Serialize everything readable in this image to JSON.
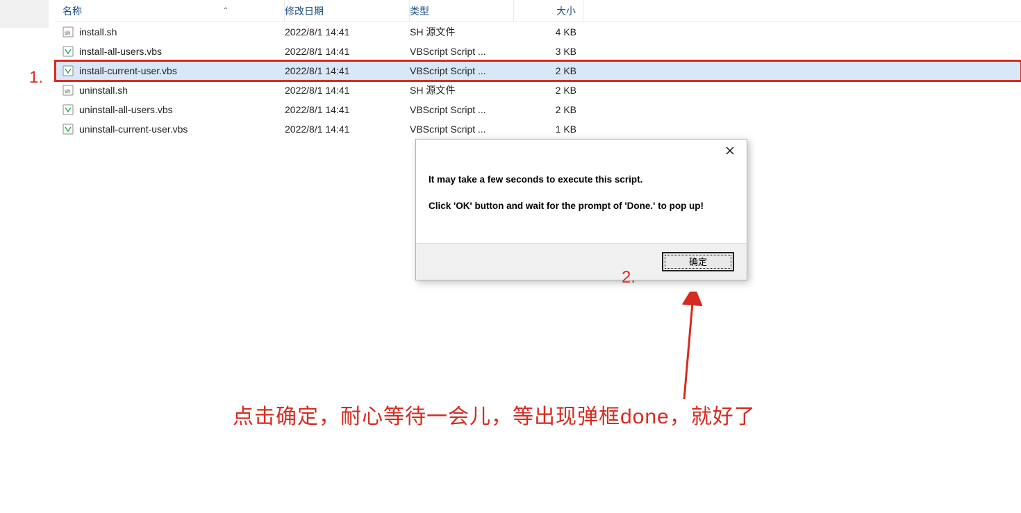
{
  "columns": {
    "name": "名称",
    "date": "修改日期",
    "type": "类型",
    "size": "大小"
  },
  "files": [
    {
      "name": "install.sh",
      "date": "2022/8/1 14:41",
      "type": "SH 源文件",
      "size": "4 KB",
      "icon": "sh",
      "sel": false
    },
    {
      "name": "install-all-users.vbs",
      "date": "2022/8/1 14:41",
      "type": "VBScript Script ...",
      "size": "3 KB",
      "icon": "vbs",
      "sel": false
    },
    {
      "name": "install-current-user.vbs",
      "date": "2022/8/1 14:41",
      "type": "VBScript Script ...",
      "size": "2 KB",
      "icon": "vbs",
      "sel": true
    },
    {
      "name": "uninstall.sh",
      "date": "2022/8/1 14:41",
      "type": "SH 源文件",
      "size": "2 KB",
      "icon": "sh",
      "sel": false
    },
    {
      "name": "uninstall-all-users.vbs",
      "date": "2022/8/1 14:41",
      "type": "VBScript Script ...",
      "size": "2 KB",
      "icon": "vbs",
      "sel": false
    },
    {
      "name": "uninstall-current-user.vbs",
      "date": "2022/8/1 14:41",
      "type": "VBScript Script ...",
      "size": "1 KB",
      "icon": "vbs",
      "sel": false
    }
  ],
  "annotations": {
    "step1": "1.",
    "step2": "2.",
    "instruction": "点击确定，耐心等待一会儿，等出现弹框done，就好了"
  },
  "dialog": {
    "line1": "It may take a few seconds to execute this script.",
    "line2": "Click 'OK' button and wait for the prompt of 'Done.' to pop up!",
    "ok": "确定"
  }
}
